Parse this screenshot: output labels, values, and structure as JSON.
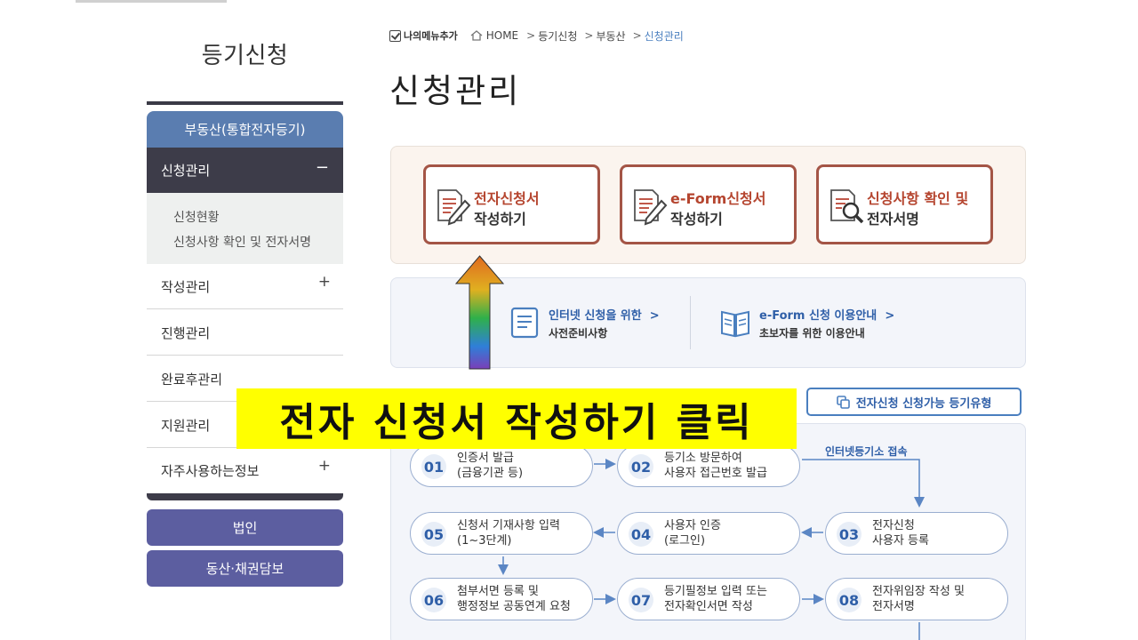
{
  "sidebar": {
    "title": "등기신청",
    "section_realestate": "부동산(통합전자등기)",
    "active_item": {
      "label": "신청관리",
      "sign": "−"
    },
    "sub_items": [
      "신청현황",
      "신청사항 확인 및 전자서명"
    ],
    "items": [
      {
        "label": "작성관리",
        "sign": "+"
      },
      {
        "label": "진행관리",
        "sign": ""
      },
      {
        "label": "완료후관리",
        "sign": ""
      },
      {
        "label": "지원관리",
        "sign": ""
      },
      {
        "label": "자주사용하는정보",
        "sign": "+"
      }
    ],
    "corp_label": "법인",
    "movable_label": "동산·채권담보"
  },
  "breadcrumb": {
    "my_menu": "나의메뉴추가",
    "home": "HOME",
    "items": [
      "등기신청",
      "부동산"
    ],
    "current": "신청관리",
    "sep": ">"
  },
  "page_title": "신청관리",
  "main_buttons": [
    {
      "title": "전자신청서",
      "subtitle": "작성하기",
      "icon": "document-pen-icon"
    },
    {
      "title": "e-Form신청서",
      "subtitle": "작성하기",
      "icon": "document-pen-icon"
    },
    {
      "title": "신청사항 확인 및",
      "subtitle": "전자서명",
      "icon": "document-magnifier-icon"
    }
  ],
  "info_links": [
    {
      "title": "인터넷 신청을 위한",
      "chevron": ">",
      "subtitle": "사전준비사항",
      "icon": "document-list-icon"
    },
    {
      "title": "e-Form 신청 이용안내",
      "chevron": ">",
      "subtitle": "초보자를 위한 이용안내",
      "icon": "open-book-icon"
    }
  ],
  "types_button": "전자신청 신청가능 등기유형",
  "process": {
    "internet_label": "인터넷등기소 접속",
    "steps": [
      {
        "num": "01",
        "line1": "인증서 발급",
        "line2": "(금융기관 등)"
      },
      {
        "num": "02",
        "line1": "등기소 방문하여",
        "line2": "사용자 접근번호 발급"
      },
      {
        "num": "03",
        "line1": "전자신청",
        "line2": "사용자 등록"
      },
      {
        "num": "04",
        "line1": "사용자 인증",
        "line2": "(로그인)"
      },
      {
        "num": "05",
        "line1": "신청서 기재사항 입력",
        "line2": "(1~3단계)"
      },
      {
        "num": "06",
        "line1": "첨부서면 등록 및",
        "line2": "행정정보 공동연계 요청"
      },
      {
        "num": "07",
        "line1": "등기필정보 입력 또는",
        "line2": "전자확인서면 작성"
      },
      {
        "num": "08",
        "line1": "전자위임장 작성 및",
        "line2": "전자서명"
      }
    ]
  },
  "callout": "전자 신청서 작성하기 클릭",
  "colors": {
    "accent_red": "#a45546",
    "accent_blue": "#2f5fa8",
    "sidebar_dark": "#3d3c49",
    "sidebar_blue": "#5a7db0",
    "sidebar_purple": "#5c5ea0",
    "callout_bg": "#ffff00"
  }
}
